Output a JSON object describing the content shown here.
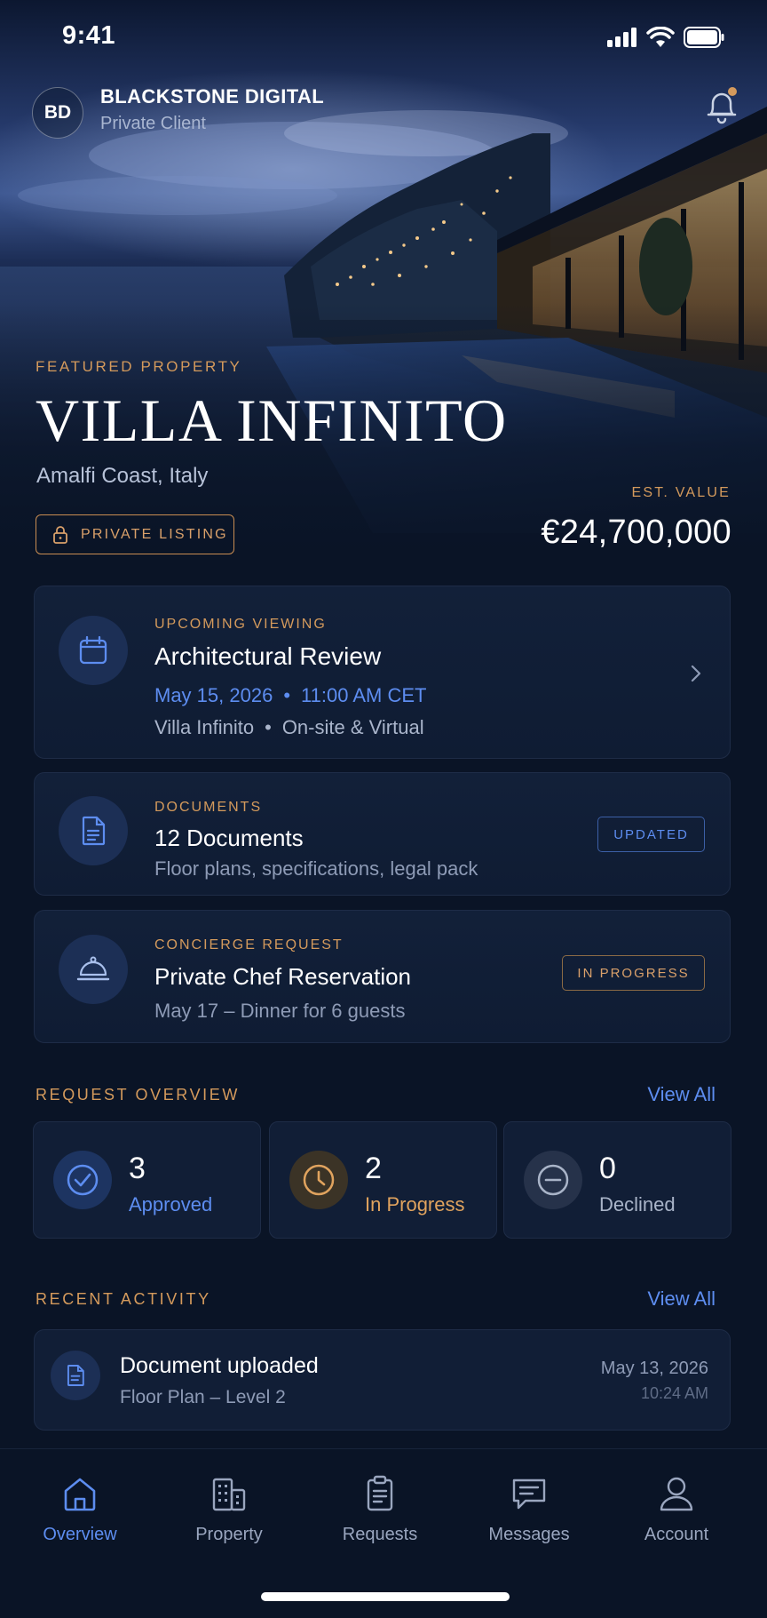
{
  "status": {
    "time": "9:41"
  },
  "header": {
    "avatar_initials": "BD",
    "company": "BLACKSTONE DIGITAL",
    "client_type": "Private Client",
    "notification_dot": "#d49a5c"
  },
  "featured": {
    "label": "FEATURED PROPERTY",
    "title": "VILLA INFINITO",
    "location": "Amalfi Coast, Italy",
    "chip": "PRIVATE LISTING",
    "est_label": "EST. VALUE",
    "est_value": "€24,700,000"
  },
  "viewing": {
    "label": "UPCOMING VIEWING",
    "title": "Architectural Review",
    "date": "May 15, 2026",
    "time": "11:00 AM CET",
    "place": "Villa Infinito",
    "mode": "On-site & Virtual",
    "separator": "•"
  },
  "documents": {
    "label": "DOCUMENTS",
    "title": "12 Documents",
    "subtitle": "Floor plans, specifications, legal pack",
    "badge": "UPDATED"
  },
  "concierge": {
    "label": "CONCIERGE REQUEST",
    "title": "Private Chef Reservation",
    "subtitle": "May 17 – Dinner for 6 guests",
    "badge": "IN PROGRESS"
  },
  "overview": {
    "label": "REQUEST OVERVIEW",
    "view_all": "View All",
    "stats": [
      {
        "count": "3",
        "label": "Approved",
        "color": "#5d8df0"
      },
      {
        "count": "2",
        "label": "In Progress",
        "color": "#e0a35e"
      },
      {
        "count": "0",
        "label": "Declined",
        "color": "#a9b4c8"
      }
    ]
  },
  "activity": {
    "label": "RECENT ACTIVITY",
    "view_all": "View All",
    "items": [
      {
        "title": "Document uploaded",
        "subtitle": "Floor Plan – Level 2",
        "date": "May 13, 2026",
        "time": "10:24 AM"
      }
    ]
  },
  "tabs": [
    {
      "label": "Overview",
      "icon": "home-icon",
      "active": true
    },
    {
      "label": "Property",
      "icon": "building-icon",
      "active": false
    },
    {
      "label": "Requests",
      "icon": "clipboard-icon",
      "active": false
    },
    {
      "label": "Messages",
      "icon": "chat-icon",
      "active": false
    },
    {
      "label": "Account",
      "icon": "user-icon",
      "active": false
    }
  ],
  "colors": {
    "accent_gold": "#d49a5c",
    "accent_blue": "#5d8df0",
    "background": "#0a1426"
  }
}
